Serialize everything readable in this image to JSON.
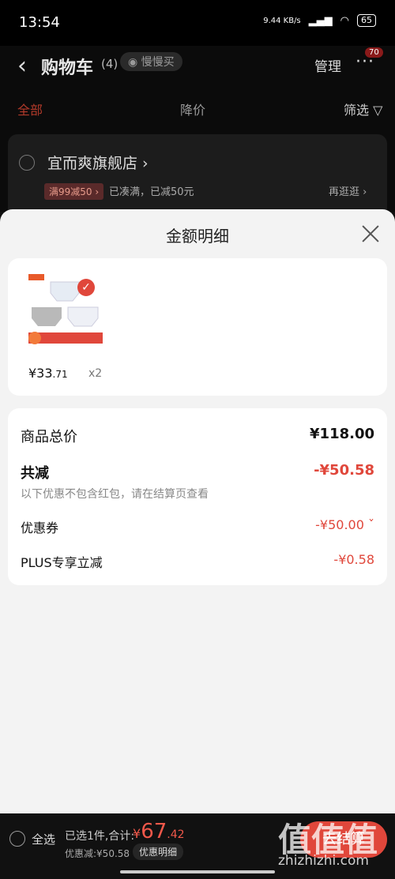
{
  "status": {
    "time": "13:54",
    "net": "9.44 KB/s",
    "battery": "65"
  },
  "header": {
    "back": "‹",
    "title": "购物车",
    "count": "(4)",
    "slow_buy": "慢慢买",
    "manage": "管理",
    "more": "···",
    "badge": "70"
  },
  "tabs": {
    "all": "全部",
    "price_drop": "降价",
    "filter": "筛选"
  },
  "store": {
    "name": "宜而爽旗舰店 ›",
    "promo": "满99减50 ›",
    "promo_text": "已凑满，已减50元",
    "more": "再逛逛 ›"
  },
  "sheet": {
    "title": "金额明细",
    "item": {
      "price_main": "¥33",
      "price_dec": ".71",
      "qty": "x2"
    },
    "summary": [
      {
        "label": "商品总价",
        "value": "¥118.00"
      },
      {
        "label": "共减",
        "value": "-¥50.58"
      }
    ],
    "note": "以下优惠不包含红包，请在结算页查看",
    "details": [
      {
        "label": "优惠券",
        "value": "-¥50.00 ˇ"
      },
      {
        "label": "PLUS专享立减",
        "value": "-¥0.58"
      }
    ]
  },
  "bottom": {
    "select_all": "全选",
    "selected": "已选1件,合计:",
    "currency": "¥",
    "total_int": "67",
    "total_dec": ".42",
    "discount": "优惠减:¥50.58",
    "detail_btn": "优惠明细",
    "checkout": "去结算"
  },
  "watermark": {
    "big": "值值值",
    "small": "zhizhizhi.com"
  },
  "colors": {
    "accent": "#e0473b"
  }
}
